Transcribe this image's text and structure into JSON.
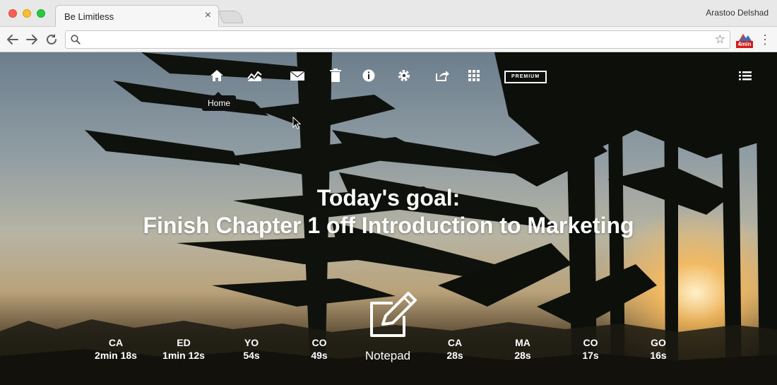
{
  "browser": {
    "tab_title": "Be Limitless",
    "tab_close": "×",
    "profile_name": "Arastoo Delshad",
    "address": {
      "value": "",
      "placeholder": ""
    },
    "extension_badge": "4min"
  },
  "nav": {
    "icons": [
      "home-icon",
      "graph-icon",
      "mail-icon",
      "trash-icon",
      "info-icon",
      "gear-icon",
      "share-icon",
      "grid-icon",
      "list-icon"
    ],
    "premium_label": "PREMIUM",
    "tooltip": "Home"
  },
  "goal": {
    "line1": "Today's goal:",
    "line2": "Finish Chapter 1 off Introduction to Marketing"
  },
  "timers_left": [
    {
      "abbr": "CA",
      "time": "2min 18s"
    },
    {
      "abbr": "ED",
      "time": "1min 12s"
    },
    {
      "abbr": "YO",
      "time": "54s"
    },
    {
      "abbr": "CO",
      "time": "49s"
    }
  ],
  "notepad": {
    "label": "Notepad"
  },
  "timers_right": [
    {
      "abbr": "CA",
      "time": "28s"
    },
    {
      "abbr": "MA",
      "time": "28s"
    },
    {
      "abbr": "CO",
      "time": "17s"
    },
    {
      "abbr": "GO",
      "time": "16s"
    }
  ],
  "colors": {
    "tooltip_bg": "#111111",
    "text": "#ffffff"
  }
}
